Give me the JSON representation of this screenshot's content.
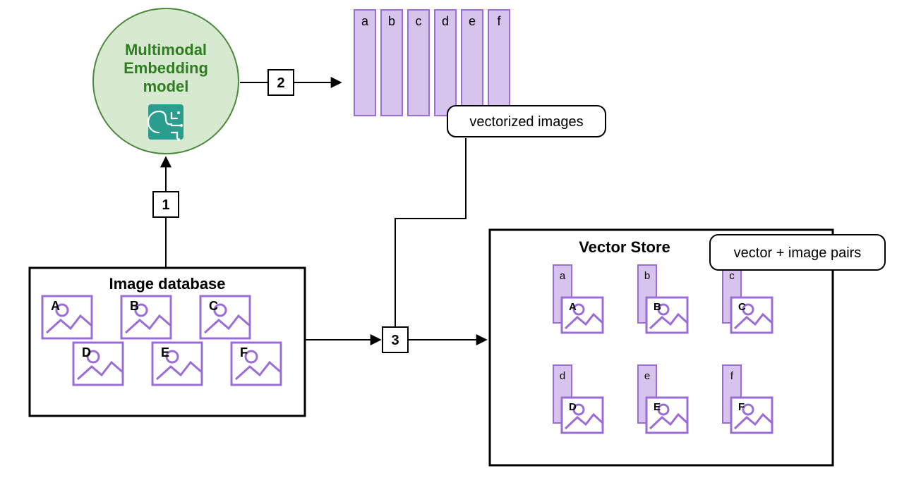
{
  "model": {
    "line1": "Multimodal",
    "line2": "Embedding",
    "line3": "model"
  },
  "steps": {
    "s1": "1",
    "s2": "2",
    "s3": "3"
  },
  "vectors": {
    "label": "vectorized images",
    "letters": [
      "a",
      "b",
      "c",
      "d",
      "e",
      "f"
    ]
  },
  "image_db": {
    "title": "Image database",
    "items": [
      "A",
      "B",
      "C",
      "D",
      "E",
      "F"
    ]
  },
  "vector_store": {
    "title": "Vector Store",
    "pill": "vector + image pairs",
    "pairs": [
      {
        "vec": "a",
        "img": "A"
      },
      {
        "vec": "b",
        "img": "B"
      },
      {
        "vec": "c",
        "img": "C"
      },
      {
        "vec": "d",
        "img": "D"
      },
      {
        "vec": "e",
        "img": "E"
      },
      {
        "vec": "f",
        "img": "F"
      }
    ]
  }
}
